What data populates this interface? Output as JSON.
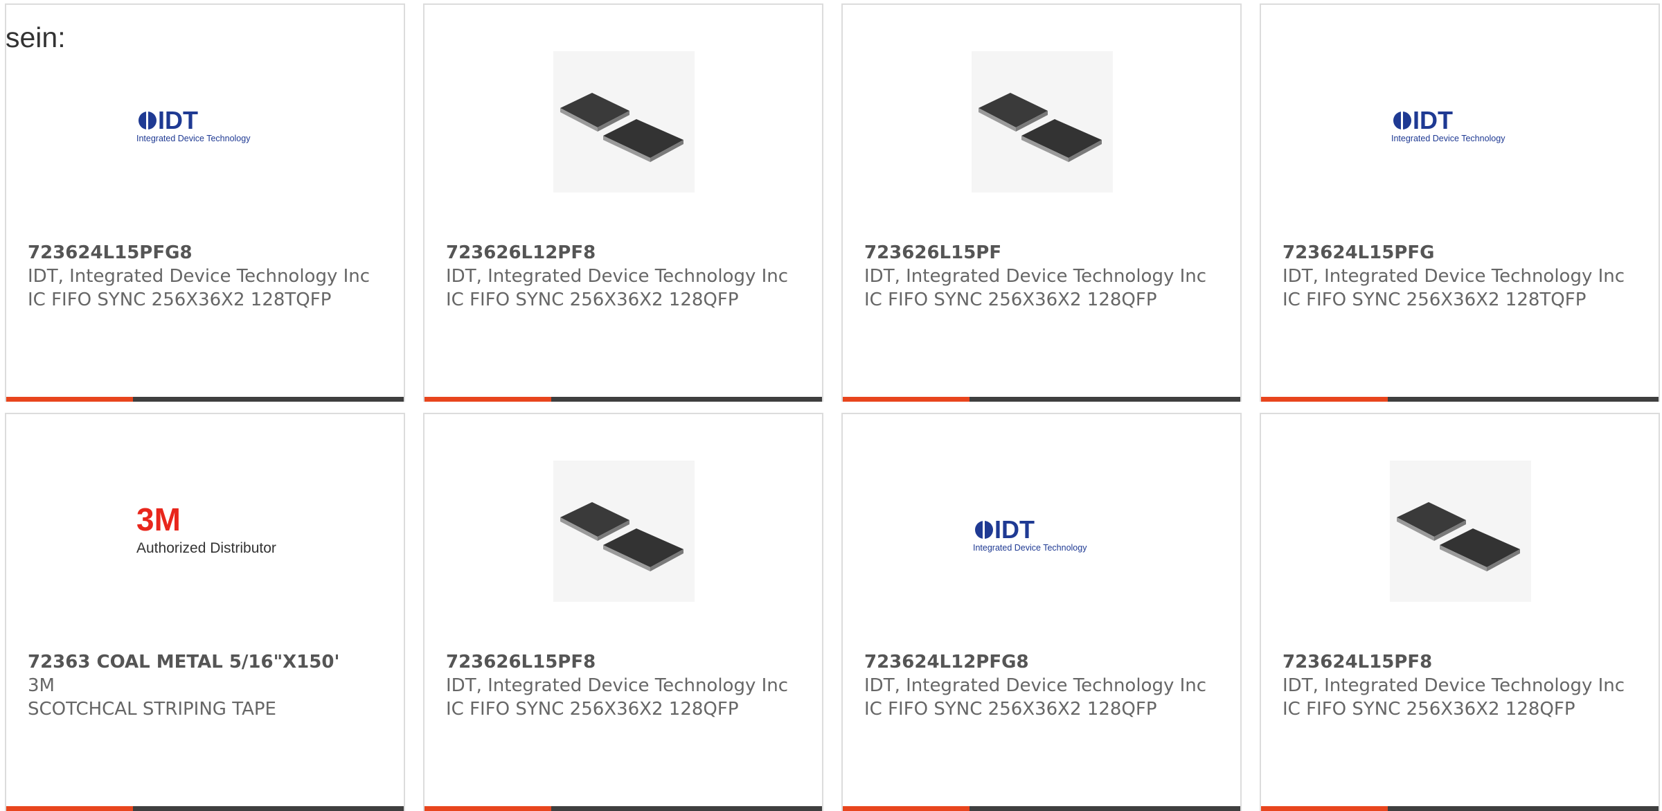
{
  "heading": "sein:",
  "products": [
    {
      "part_number": "723624L15PFG8",
      "manufacturer": "IDT, Integrated Device Technology Inc",
      "description": "IC FIFO SYNC 256X36X2 128TQFP",
      "image": "idt-logo"
    },
    {
      "part_number": "723626L12PF8",
      "manufacturer": "IDT, Integrated Device Technology Inc",
      "description": "IC FIFO SYNC 256X36X2 128QFP",
      "image": "chip-photo"
    },
    {
      "part_number": "723626L15PF",
      "manufacturer": "IDT, Integrated Device Technology Inc",
      "description": "IC FIFO SYNC 256X36X2 128QFP",
      "image": "chip-photo"
    },
    {
      "part_number": "723624L15PFG",
      "manufacturer": "IDT, Integrated Device Technology Inc",
      "description": "IC FIFO SYNC 256X36X2 128TQFP",
      "image": "idt-logo"
    },
    {
      "part_number": "72363 COAL METAL 5/16\"X150'",
      "manufacturer": "3M",
      "description": "SCOTCHCAL STRIPING TAPE",
      "image": "3m-logo"
    },
    {
      "part_number": "723626L15PF8",
      "manufacturer": "IDT, Integrated Device Technology Inc",
      "description": "IC FIFO SYNC 256X36X2 128QFP",
      "image": "chip-photo"
    },
    {
      "part_number": "723624L12PFG8",
      "manufacturer": "IDT, Integrated Device Technology Inc",
      "description": "IC FIFO SYNC 256X36X2 128QFP",
      "image": "idt-logo"
    },
    {
      "part_number": "723624L15PF8",
      "manufacturer": "IDT, Integrated Device Technology Inc",
      "description": "IC FIFO SYNC 256X36X2 128QFP",
      "image": "chip-photo"
    }
  ],
  "logos": {
    "idt": {
      "mark": "IDT",
      "tagline": "Integrated Device Technology",
      "color": "#1f3a93"
    },
    "3m": {
      "mark": "3M",
      "tagline": "Authorized Distributor",
      "color": "#e8261c"
    }
  },
  "colors": {
    "accent": "#e8451d",
    "bar": "#3f3f3f",
    "border": "#dcdcdc"
  }
}
